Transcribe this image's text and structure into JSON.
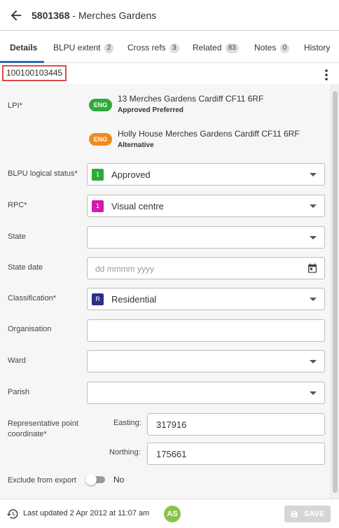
{
  "header": {
    "record_id": "5801368",
    "separator": " - ",
    "street": "Merches Gardens"
  },
  "tabs": [
    {
      "label": "Details",
      "count": ""
    },
    {
      "label": "BLPU extent",
      "count": "2"
    },
    {
      "label": "Cross refs",
      "count": "3"
    },
    {
      "label": "Related",
      "count": "83"
    },
    {
      "label": "Notes",
      "count": "0"
    },
    {
      "label": "History",
      "count": ""
    }
  ],
  "uprn": "100100103445",
  "lpi": {
    "label": "LPI*",
    "entries": [
      {
        "lang": "ENG",
        "address": "13 Merches Gardens Cardiff CF11 6RF",
        "status": "Approved Preferred",
        "color": "#2eaa3a"
      },
      {
        "lang": "ENG",
        "address": "Holly House Merches Gardens Cardiff CF11 6RF",
        "status": "Alternative",
        "color": "#f08a1c"
      }
    ]
  },
  "fields": {
    "logical_status": {
      "label": "BLPU logical status*",
      "code": "1",
      "value": "Approved",
      "color": "#2eaa3a"
    },
    "rpc": {
      "label": "RPC*",
      "code": "1",
      "value": "Visual centre",
      "color": "#d21bb0"
    },
    "state": {
      "label": "State",
      "value": ""
    },
    "state_date": {
      "label": "State date",
      "placeholder": "dd mmmm yyyy"
    },
    "classification": {
      "label": "Classification*",
      "code": "R",
      "value": "Residential",
      "color": "#2b2d8a"
    },
    "organisation": {
      "label": "Organisation",
      "value": ""
    },
    "ward": {
      "label": "Ward",
      "value": ""
    },
    "parish": {
      "label": "Parish",
      "value": ""
    },
    "rep_point": {
      "label_line1": "Representative point",
      "label_line2": "coordinate*",
      "easting_label": "Easting:",
      "easting": "317916",
      "northing_label": "Northing:",
      "northing": "175661"
    },
    "exclude": {
      "label": "Exclude from export",
      "value": "No"
    }
  },
  "footer": {
    "updated": "Last updated 2 Apr 2012 at 11:07 am",
    "avatar": "AS",
    "save_label": "SAVE"
  }
}
